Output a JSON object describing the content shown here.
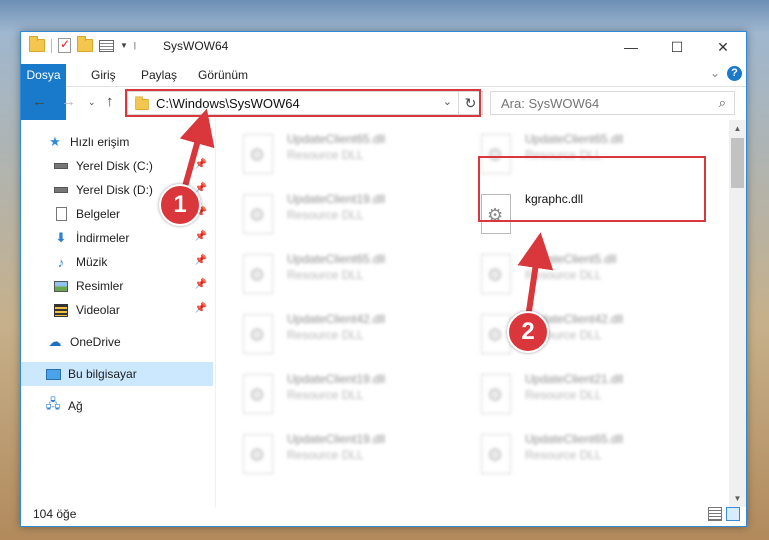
{
  "window": {
    "title": "SysWOW64",
    "minimize": "—",
    "maximize": "☐",
    "close": "✕"
  },
  "ribbon": {
    "tabs": [
      {
        "label": "Dosya"
      },
      {
        "label": "Giriş"
      },
      {
        "label": "Paylaş"
      },
      {
        "label": "Görünüm"
      }
    ],
    "help": "?"
  },
  "address": {
    "path": "C:\\Windows\\SysWOW64",
    "placeholder": "Ara: SysWOW64"
  },
  "sidebar": {
    "items": [
      {
        "label": "Hızlı erişim",
        "icon": "star-icon"
      },
      {
        "label": "Yerel Disk (C:)",
        "icon": "drive-icon"
      },
      {
        "label": "Yerel Disk (D:)",
        "icon": "drive-icon"
      },
      {
        "label": "Belgeler",
        "icon": "document-icon"
      },
      {
        "label": "İndirmeler",
        "icon": "download-icon"
      },
      {
        "label": "Müzik",
        "icon": "music-icon"
      },
      {
        "label": "Resimler",
        "icon": "pictures-icon"
      },
      {
        "label": "Videolar",
        "icon": "video-icon"
      },
      {
        "label": "OneDrive",
        "icon": "cloud-icon"
      },
      {
        "label": "Bu bilgisayar",
        "icon": "computer-icon"
      },
      {
        "label": "Ağ",
        "icon": "network-icon"
      }
    ]
  },
  "files": {
    "left": [
      {
        "name": "UpdateClient65.dll",
        "type": "Resource DLL"
      },
      {
        "name": "UpdateClient19.dll",
        "type": "Resource DLL"
      },
      {
        "name": "UpdateClient65.dll",
        "type": "Resource DLL"
      },
      {
        "name": "UpdateClient42.dll",
        "type": "Resource DLL"
      },
      {
        "name": "UpdateClient19.dll",
        "type": "Resource DLL"
      },
      {
        "name": "UpdateClient19.dll",
        "type": "Resource DLL"
      }
    ],
    "right": [
      {
        "name": "UpdateClient65.dll",
        "type": "Resource DLL"
      },
      {
        "name": "kgraphc.dll",
        "type": ""
      },
      {
        "name": "UpdateClient5.dll",
        "type": "Resource DLL"
      },
      {
        "name": "UpdateClient42.dll",
        "type": "Resource DLL"
      },
      {
        "name": "UpdateClient21.dll",
        "type": "Resource DLL"
      },
      {
        "name": "UpdateClient65.dll",
        "type": "Resource DLL"
      }
    ]
  },
  "status": {
    "count": "104 öğe"
  },
  "annotations": {
    "step1": "1",
    "step2": "2",
    "color": "#d9373b"
  }
}
